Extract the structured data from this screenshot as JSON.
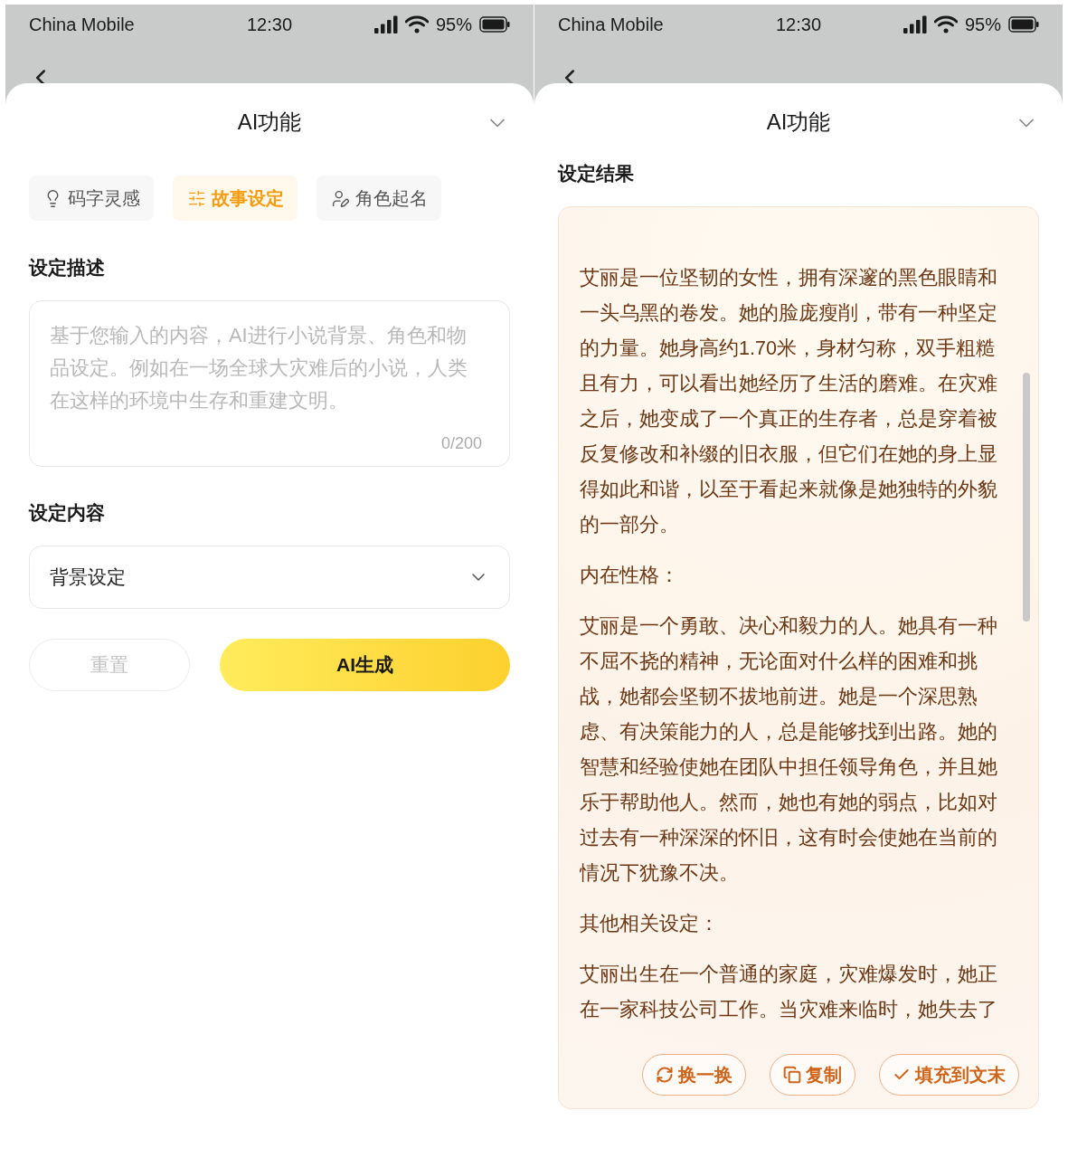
{
  "screens": [
    {
      "kind": "form",
      "status_bar": {
        "carrier": "China Mobile",
        "time": "12:30",
        "battery": "95%"
      },
      "sheet_title": "AI功能",
      "tabs": [
        {
          "label": "码字灵感",
          "selected": false
        },
        {
          "label": "故事设定",
          "selected": true
        },
        {
          "label": "角色起名",
          "selected": false
        }
      ],
      "description": {
        "label": "设定描述",
        "placeholder": "基于您输入的内容，AI进行小说背景、角色和物品设定。例如在一场全球大灾难后的小说，人类在这样的环境中生存和重建文明。",
        "counter": "0/200"
      },
      "content": {
        "label": "设定内容",
        "value": "背景设定"
      },
      "buttons": [
        {
          "label": "重置",
          "kind": "outline",
          "disabled": true
        },
        {
          "label": "AI生成",
          "kind": "gradient",
          "disabled": false
        }
      ]
    },
    {
      "kind": "result",
      "status_bar": {
        "carrier": "China Mobile",
        "time": "12:30",
        "battery": "95%"
      },
      "sheet_title": "AI功能",
      "result": {
        "label": "设定结果",
        "paragraphs": [
          "艾丽是一位坚韧的女性，拥有深邃的黑色眼睛和一头乌黑的卷发。她的脸庞瘦削，带有一种坚定的力量。她身高约1.70米，身材匀称，双手粗糙且有力，可以看出她经历了生活的磨难。在灾难之后，她变成了一个真正的生存者，总是穿着被反复修改和补缀的旧衣服，但它们在她的身上显得如此和谐，以至于看起来就像是她独特的外貌的一部分。",
          "内在性格：",
          "艾丽是一个勇敢、决心和毅力的人。她具有一种不屈不挠的精神，无论面对什么样的困难和挑战，她都会坚韧不拔地前进。她是一个深思熟虑、有决策能力的人，总是能够找到出路。她的智慧和经验使她在团队中担任领导角色，并且她乐于帮助他人。然而，她也有她的弱点，比如对过去有一种深深的怀旧，这有时会使她在当前的情况下犹豫不决。",
          "其他相关设定：",
          "艾丽出生在一个普通的家庭，灾难爆发时，她正在一家科技公司工作。当灾难来临时，她失去了"
        ],
        "actions": [
          {
            "label": "换一换"
          },
          {
            "label": "复制"
          },
          {
            "label": "填充到文末"
          }
        ]
      }
    }
  ]
}
